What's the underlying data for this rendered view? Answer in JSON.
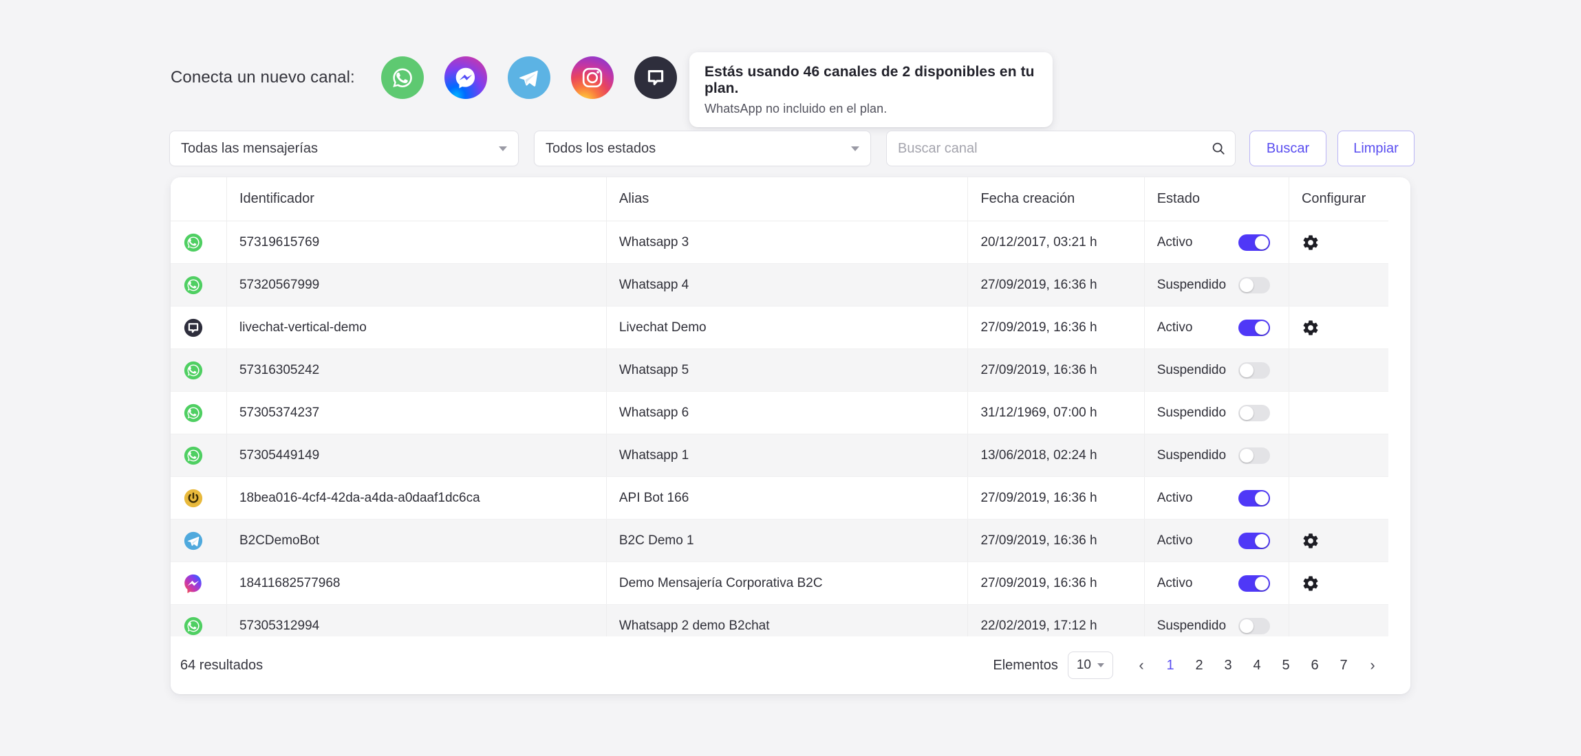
{
  "connect": {
    "label": "Conecta un nuevo canal:",
    "channels": [
      {
        "name": "whatsapp-channel-button",
        "icon": "whatsapp-icon"
      },
      {
        "name": "messenger-channel-button",
        "icon": "messenger-icon"
      },
      {
        "name": "telegram-channel-button",
        "icon": "telegram-icon"
      },
      {
        "name": "instagram-channel-button",
        "icon": "instagram-icon"
      },
      {
        "name": "livechat-channel-button",
        "icon": "livechat-icon"
      }
    ]
  },
  "plan_notice": {
    "title": "Estás usando 46 canales de 2 disponibles en tu plan.",
    "subtitle": "WhatsApp no incluido en el plan."
  },
  "filters": {
    "messaging_select": "Todas las mensajerías",
    "status_select": "Todos los estados",
    "search_placeholder": "Buscar canal",
    "search_value": "",
    "search_button": "Buscar",
    "clear_button": "Limpiar"
  },
  "table": {
    "headers": {
      "icon": "",
      "identifier": "Identificador",
      "alias": "Alias",
      "created": "Fecha creación",
      "state": "Estado",
      "configure": "Configurar"
    },
    "rows": [
      {
        "icon": "whatsapp-icon",
        "identifier": "57319615769",
        "alias": "Whatsapp 3",
        "created": "20/12/2017, 03:21 h",
        "state": "Activo",
        "toggle": true,
        "configurable": true
      },
      {
        "icon": "whatsapp-icon",
        "identifier": "57320567999",
        "alias": "Whatsapp 4",
        "created": "27/09/2019, 16:36 h",
        "state": "Suspendido",
        "toggle": false,
        "configurable": false
      },
      {
        "icon": "livechat-icon",
        "identifier": "livechat-vertical-demo",
        "alias": "Livechat Demo",
        "created": "27/09/2019, 16:36 h",
        "state": "Activo",
        "toggle": true,
        "configurable": true
      },
      {
        "icon": "whatsapp-icon",
        "identifier": "57316305242",
        "alias": "Whatsapp 5",
        "created": "27/09/2019, 16:36 h",
        "state": "Suspendido",
        "toggle": false,
        "configurable": false
      },
      {
        "icon": "whatsapp-icon",
        "identifier": "57305374237",
        "alias": "Whatsapp 6",
        "created": "31/12/1969, 07:00 h",
        "state": "Suspendido",
        "toggle": false,
        "configurable": false
      },
      {
        "icon": "whatsapp-icon",
        "identifier": "57305449149",
        "alias": "Whatsapp 1",
        "created": "13/06/2018, 02:24 h",
        "state": "Suspendido",
        "toggle": false,
        "configurable": false
      },
      {
        "icon": "apibot-icon",
        "identifier": "18bea016-4cf4-42da-a4da-a0daaf1dc6ca",
        "alias": "API Bot 166",
        "created": "27/09/2019, 16:36 h",
        "state": "Activo",
        "toggle": true,
        "configurable": false
      },
      {
        "icon": "telegram-icon",
        "identifier": "B2CDemoBot",
        "alias": "B2C Demo 1",
        "created": "27/09/2019, 16:36 h",
        "state": "Activo",
        "toggle": true,
        "configurable": true
      },
      {
        "icon": "messenger-icon",
        "identifier": "18411682577968",
        "alias": "Demo Mensajería Corporativa B2C",
        "created": "27/09/2019, 16:36 h",
        "state": "Activo",
        "toggle": true,
        "configurable": true
      },
      {
        "icon": "whatsapp-icon",
        "identifier": "57305312994",
        "alias": "Whatsapp 2 demo B2chat",
        "created": "22/02/2019, 17:12 h",
        "state": "Suspendido",
        "toggle": false,
        "configurable": false
      }
    ]
  },
  "footer": {
    "results": "64 resultados",
    "elements_label": "Elementos",
    "per_page": "10",
    "prev": "‹",
    "next": "›",
    "pages": [
      "1",
      "2",
      "3",
      "4",
      "5",
      "6",
      "7"
    ],
    "active_page": "1"
  },
  "colors": {
    "accent": "#5a4ef0",
    "toggle_on": "#4f38f7",
    "toggle_off": "#e3e3e6",
    "page_bg": "#f4f4f6",
    "card_bg": "#ffffff",
    "row_alt_bg": "#f5f5f6"
  }
}
